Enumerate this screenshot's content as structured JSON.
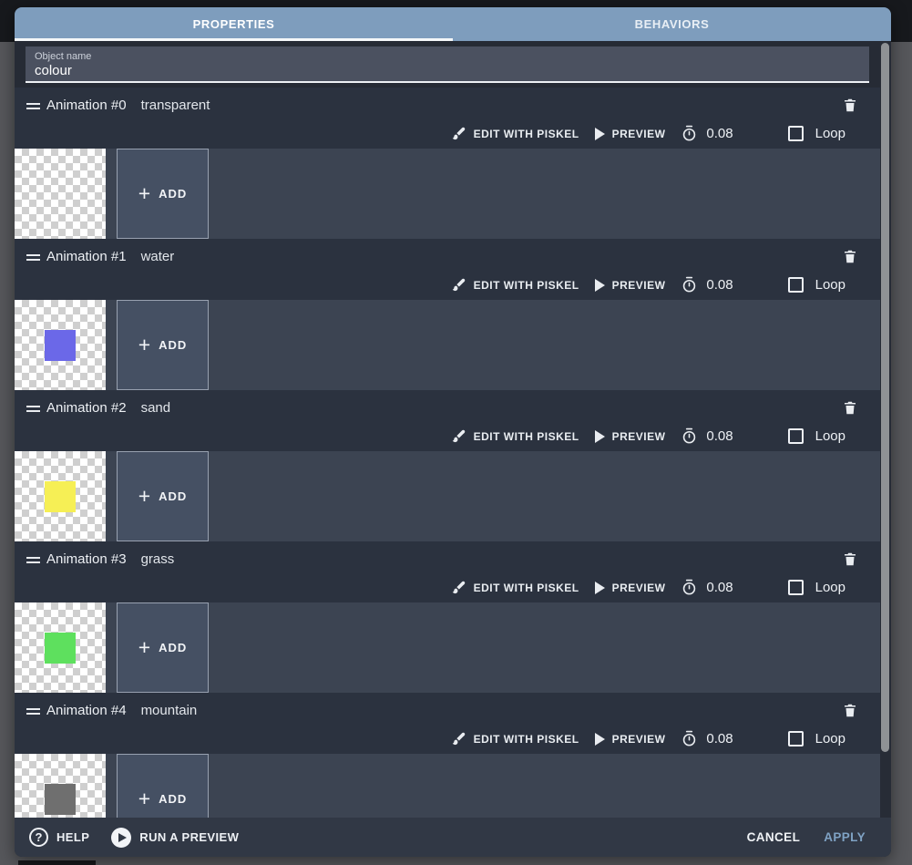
{
  "window": {
    "backdrop_color": "#56575b",
    "top_strip_color": "#17191d",
    "tab_bar_color": "#7e9dbd"
  },
  "tabs": {
    "properties": "PROPERTIES",
    "behaviors": "BEHAVIORS",
    "active_tab": "PROPERTIES"
  },
  "object_name": {
    "label": "Object name",
    "value": "colour"
  },
  "row_labels": {
    "edit": "EDIT WITH PISKEL",
    "preview": "PREVIEW",
    "time": "0.08",
    "loop": "Loop",
    "add": "ADD",
    "plus": "+"
  },
  "animations": [
    {
      "label": "Animation #0",
      "name": "transparent",
      "frame_color": "none",
      "loop_checked": false
    },
    {
      "label": "Animation #1",
      "name": "water",
      "frame_color": "#6b68e8",
      "loop_checked": false
    },
    {
      "label": "Animation #2",
      "name": "sand",
      "frame_color": "#f6ef55",
      "loop_checked": false
    },
    {
      "label": "Animation #3",
      "name": "grass",
      "frame_color": "#5ee05e",
      "loop_checked": false
    },
    {
      "label": "Animation #4",
      "name": "mountain",
      "frame_color": "#6f6f6f",
      "loop_checked": false
    }
  ],
  "icons": {
    "drag_handle": "drag-handle",
    "trash": "trash-can",
    "edit": "paintbrush",
    "preview": "play-triangle",
    "time": "stopwatch",
    "loop": "checkbox-unchecked",
    "help_glyph": "?",
    "run_preview": "play-circle"
  },
  "footer": {
    "help": "HELP",
    "run_preview": "RUN A PREVIEW",
    "cancel": "CANCEL",
    "apply": "APPLY",
    "apply_color": "#7fa2c4"
  }
}
